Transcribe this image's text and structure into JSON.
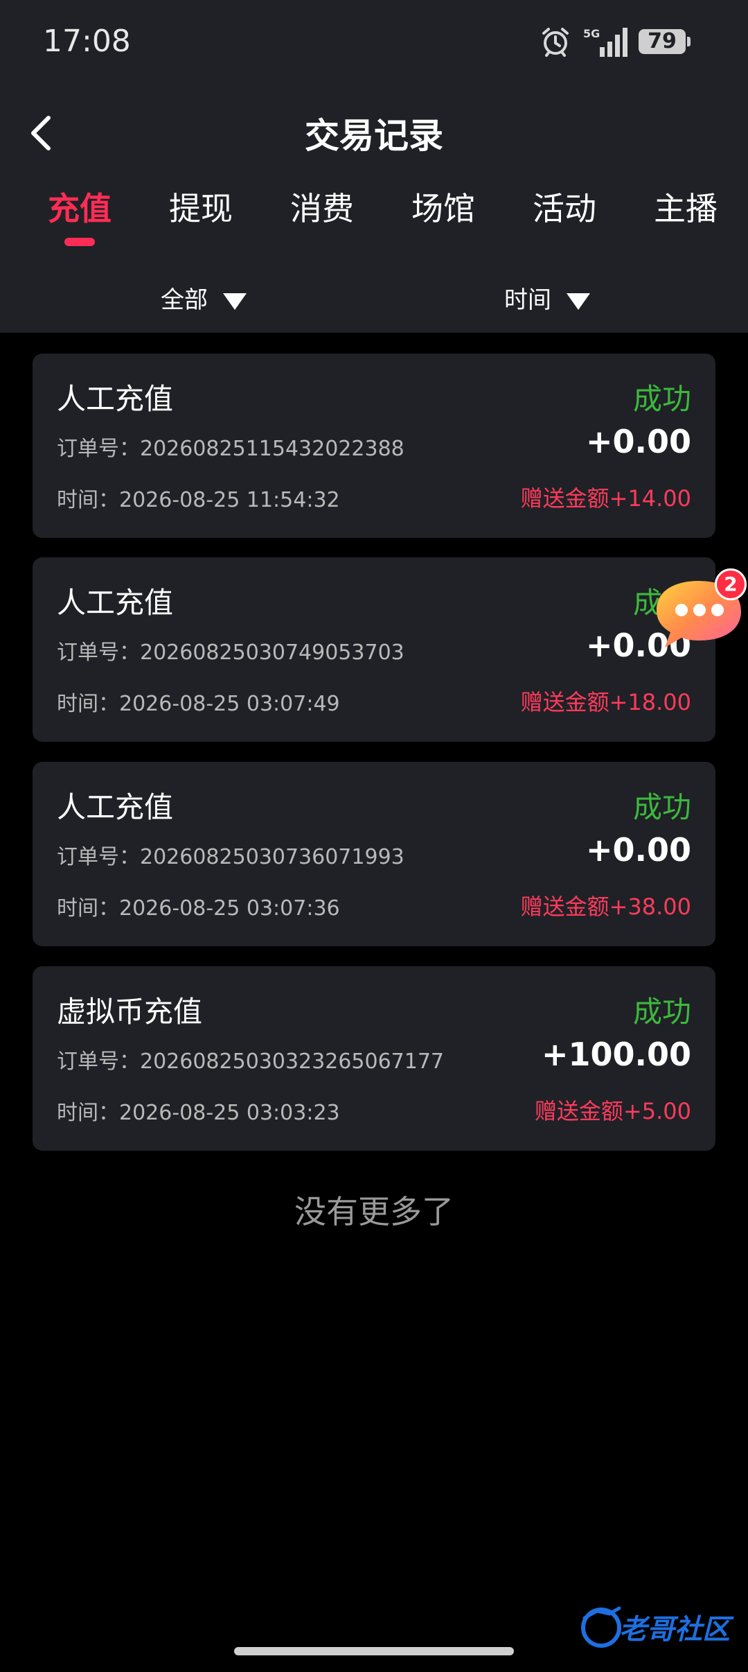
{
  "status_bar": {
    "time": "17:08",
    "network": "5G",
    "battery": "79"
  },
  "header": {
    "title": "交易记录"
  },
  "tabs": [
    {
      "label": "充值",
      "active": true
    },
    {
      "label": "提现",
      "active": false
    },
    {
      "label": "消费",
      "active": false
    },
    {
      "label": "场馆",
      "active": false
    },
    {
      "label": "活动",
      "active": false
    },
    {
      "label": "主播",
      "active": false
    }
  ],
  "filters": {
    "type": "全部",
    "time": "时间"
  },
  "records": [
    {
      "type": "人工充值",
      "status": "成功",
      "order": "订单号：20260825115432022388",
      "amount": "+0.00",
      "time": "时间：2026-08-25 11:54:32",
      "bonus": "赠送金额+14.00"
    },
    {
      "type": "人工充值",
      "status": "成功",
      "order": "订单号：20260825030749053703",
      "amount": "+0.00",
      "time": "时间：2026-08-25 03:07:49",
      "bonus": "赠送金额+18.00"
    },
    {
      "type": "人工充值",
      "status": "成功",
      "order": "订单号：20260825030736071993",
      "amount": "+0.00",
      "time": "时间：2026-08-25 03:07:36",
      "bonus": "赠送金额+38.00"
    },
    {
      "type": "虚拟币充值",
      "status": "成功",
      "order": "订单号：20260825030323265067177",
      "amount": "+100.00",
      "time": "时间：2026-08-25 03:03:23",
      "bonus": "赠送金额+5.00"
    }
  ],
  "footer": {
    "no_more": "没有更多了"
  },
  "chat": {
    "badge": "2"
  },
  "watermark": {
    "text": "老哥社区"
  },
  "colors": {
    "accent": "#ff2d55",
    "success": "#3db83d",
    "bonus": "#ff3b5c",
    "card": "#1f2126"
  }
}
